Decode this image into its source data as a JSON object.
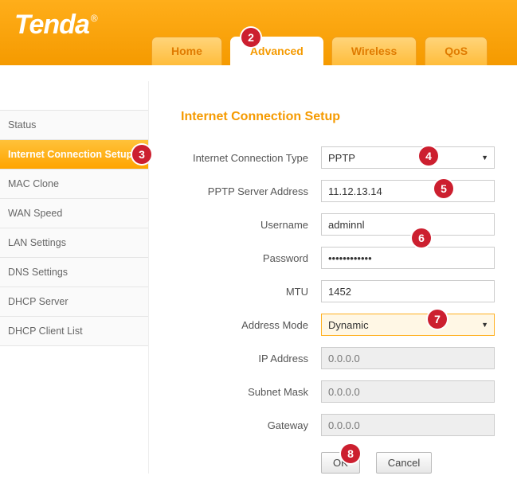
{
  "brand": "Tenda",
  "tabs": [
    {
      "label": "Home",
      "active": false
    },
    {
      "label": "Advanced",
      "active": true
    },
    {
      "label": "Wireless",
      "active": false
    },
    {
      "label": "QoS",
      "active": false
    }
  ],
  "sidebar": {
    "items": [
      {
        "label": "Status",
        "active": false
      },
      {
        "label": "Internet Connection Setup",
        "active": true
      },
      {
        "label": "MAC Clone",
        "active": false
      },
      {
        "label": "WAN Speed",
        "active": false
      },
      {
        "label": "LAN Settings",
        "active": false
      },
      {
        "label": "DNS Settings",
        "active": false
      },
      {
        "label": "DHCP Server",
        "active": false
      },
      {
        "label": "DHCP Client List",
        "active": false
      }
    ]
  },
  "section": {
    "title": "Internet Connection Setup"
  },
  "form": {
    "connection_type": {
      "label": "Internet Connection Type",
      "value": "PPTP"
    },
    "pptp_server": {
      "label": "PPTP Server Address",
      "value": "11.12.13.14"
    },
    "username": {
      "label": "Username",
      "value": "adminnl"
    },
    "password": {
      "label": "Password",
      "value": "••••••••••••"
    },
    "mtu": {
      "label": "MTU",
      "value": "1452"
    },
    "address_mode": {
      "label": "Address Mode",
      "value": "Dynamic"
    },
    "ip_address": {
      "label": "IP Address",
      "value": "0.0.0.0"
    },
    "subnet_mask": {
      "label": "Subnet Mask",
      "value": "0.0.0.0"
    },
    "gateway": {
      "label": "Gateway",
      "value": "0.0.0.0"
    }
  },
  "buttons": {
    "ok": "OK",
    "cancel": "Cancel"
  },
  "callouts": {
    "2": "2",
    "3": "3",
    "4": "4",
    "5": "5",
    "6": "6",
    "7": "7",
    "8": "8"
  }
}
